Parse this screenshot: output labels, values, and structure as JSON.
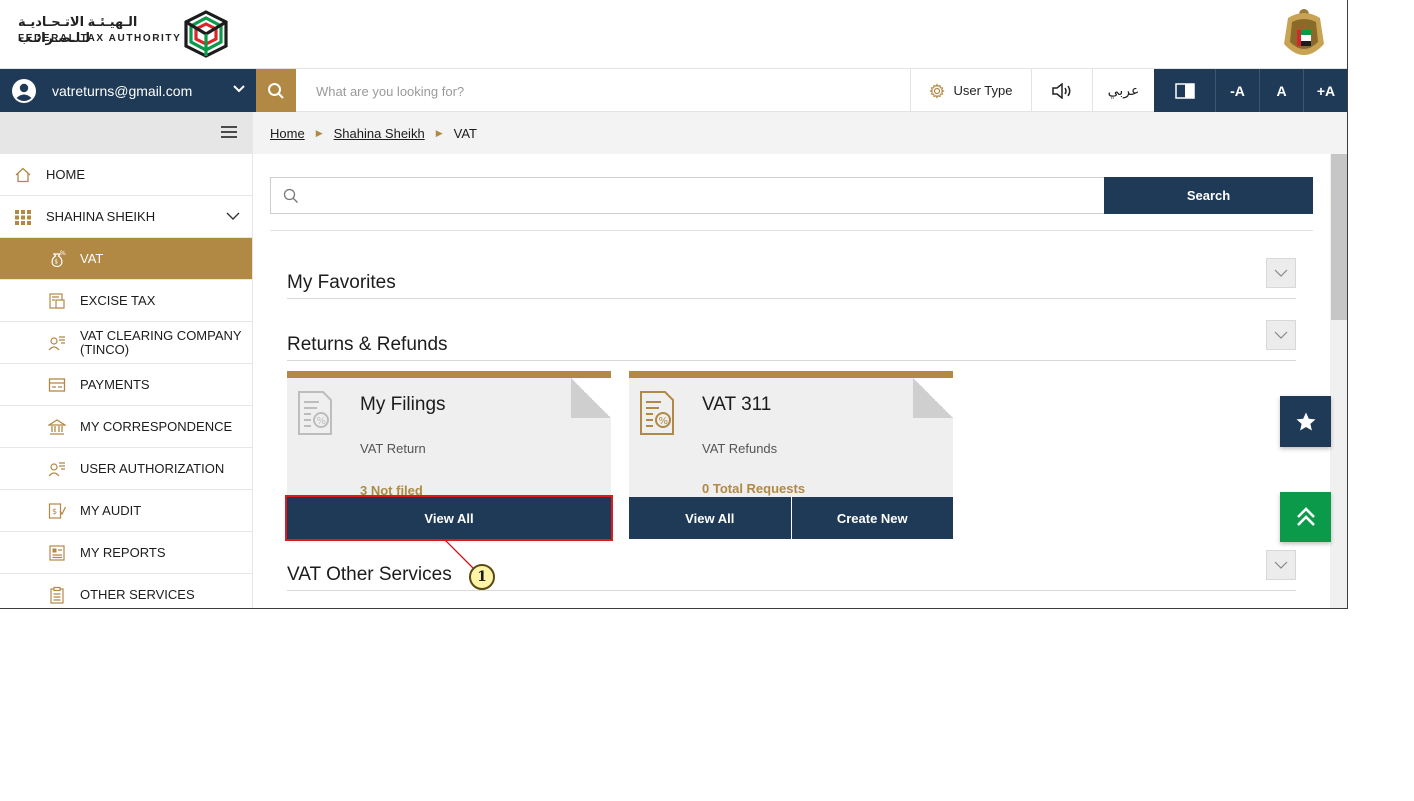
{
  "header": {
    "logo_arabic": "الـهيـئـة الاتـحـاديـة لـلـضـرائـب",
    "logo_english": "FEDERAL TAX AUTHORITY",
    "logo_icon": "fta-logo-mark",
    "emblem_icon": "uae-emblem"
  },
  "topbar": {
    "account_email": "vatreturns@gmail.com",
    "search_placeholder": "What are you looking for?",
    "user_type_label": "User Type",
    "language_label": "عربي",
    "font_decrease": "-A",
    "font_normal": "A",
    "font_increase": "+A"
  },
  "sidebar": {
    "items": [
      {
        "label": "HOME",
        "icon": "home-icon"
      },
      {
        "label": "SHAHINA SHEIKH",
        "icon": "grid-icon"
      },
      {
        "label": "VAT",
        "icon": "money-bag-icon",
        "active": true
      },
      {
        "label": "EXCISE TAX",
        "icon": "excise-icon"
      },
      {
        "label": "VAT CLEARING COMPANY (TINCO)",
        "icon": "users-list-icon"
      },
      {
        "label": "PAYMENTS",
        "icon": "card-icon"
      },
      {
        "label": "MY CORRESPONDENCE",
        "icon": "bank-icon"
      },
      {
        "label": "USER AUTHORIZATION",
        "icon": "users-list-icon"
      },
      {
        "label": "MY AUDIT",
        "icon": "audit-icon"
      },
      {
        "label": "MY REPORTS",
        "icon": "reports-icon"
      },
      {
        "label": "OTHER SERVICES",
        "icon": "clipboard-icon"
      }
    ]
  },
  "breadcrumb": {
    "items": [
      "Home",
      "Shahina Sheikh",
      "VAT"
    ]
  },
  "main": {
    "search_button": "Search",
    "sections": {
      "favorites": "My Favorites",
      "returns": "Returns & Refunds",
      "other": "VAT Other Services"
    },
    "cards": [
      {
        "title": "My Filings",
        "subtitle": "VAT Return",
        "status": "3 Not filed",
        "buttons": [
          "View All"
        ]
      },
      {
        "title": "VAT 311",
        "subtitle": "VAT Refunds",
        "status": "0 Total Requests",
        "buttons": [
          "View All",
          "Create New"
        ]
      }
    ]
  },
  "annotation": {
    "step": "1"
  },
  "colors": {
    "navy": "#1f3a57",
    "gold": "#b28845",
    "green": "#0a9a4a",
    "highlight_red": "#e0191f"
  }
}
